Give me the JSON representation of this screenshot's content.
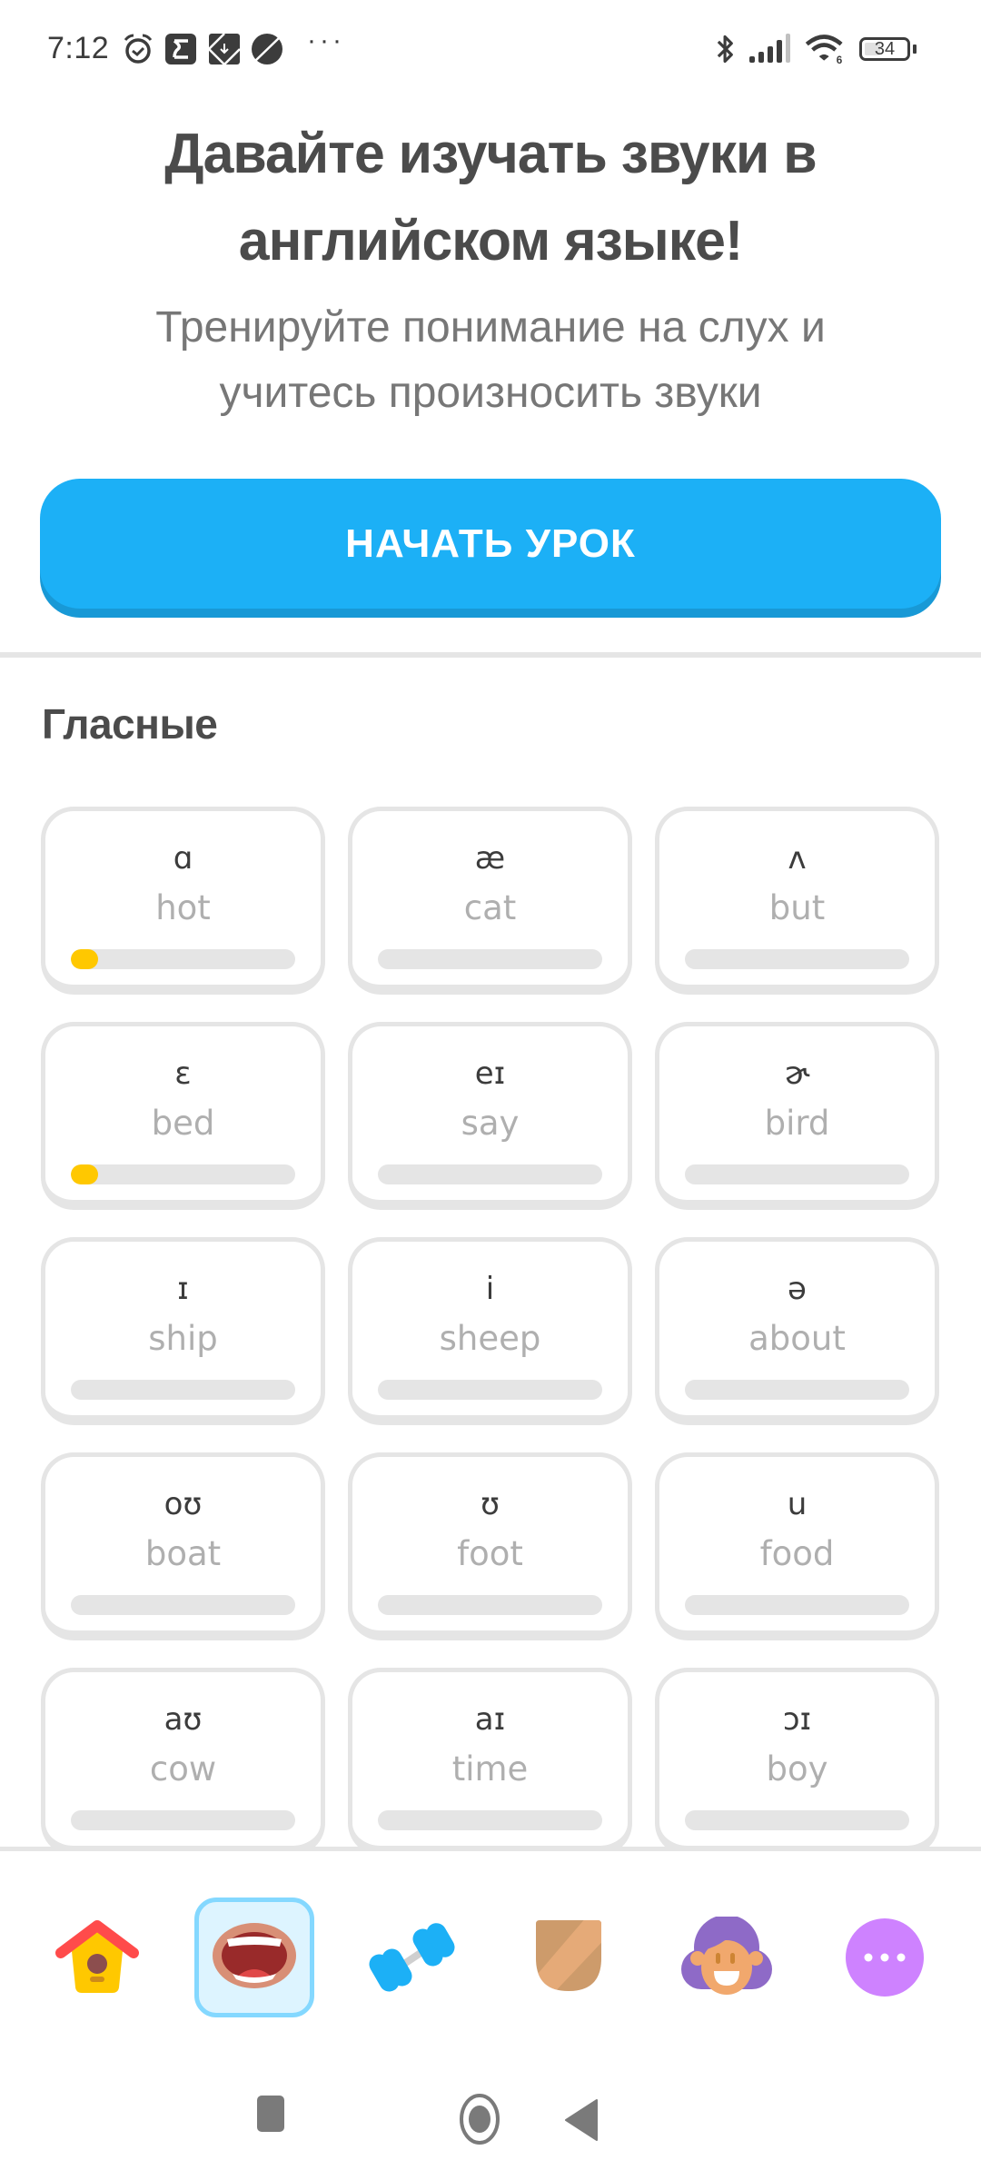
{
  "status_bar": {
    "time": "7:12",
    "left_icons": [
      "alarm-icon",
      "sigma-app-icon",
      "download-app-icon",
      "planet-app-icon"
    ],
    "more_notifications": "···",
    "right_icons": [
      "bluetooth-icon",
      "signal-icon",
      "wifi-icon"
    ],
    "wifi_badge": "6",
    "battery_percent": "34"
  },
  "header": {
    "title_line1": "Давайте изучать звуки в",
    "title_line2": "английском языке!",
    "subtitle_line1": "Тренируйте понимание на слух и",
    "subtitle_line2": "учитесь произносить звуки"
  },
  "start_button": {
    "label": "НАЧАТЬ УРОК"
  },
  "section": {
    "title": "Гласные"
  },
  "colors": {
    "accent": "#1cb0f6",
    "accent_shadow": "#1899d6",
    "progress_fill": "#ffc800",
    "progress_track": "#e5e5e5",
    "card_border": "#e5e5e5",
    "active_tab_bg": "#ddf4ff",
    "active_tab_border": "#84d8ff"
  },
  "vowels": [
    {
      "symbol": "ɑ",
      "word": "hot",
      "progress": 0.12
    },
    {
      "symbol": "æ",
      "word": "cat",
      "progress": 0
    },
    {
      "symbol": "ʌ",
      "word": "but",
      "progress": 0
    },
    {
      "symbol": "ɛ",
      "word": "bed",
      "progress": 0.12
    },
    {
      "symbol": "eɪ",
      "word": "say",
      "progress": 0
    },
    {
      "symbol": "ɚ",
      "word": "bird",
      "progress": 0
    },
    {
      "symbol": "ɪ",
      "word": "ship",
      "progress": 0
    },
    {
      "symbol": "i",
      "word": "sheep",
      "progress": 0
    },
    {
      "symbol": "ə",
      "word": "about",
      "progress": 0
    },
    {
      "symbol": "oʊ",
      "word": "boat",
      "progress": 0
    },
    {
      "symbol": "ʊ",
      "word": "foot",
      "progress": 0
    },
    {
      "symbol": "u",
      "word": "food",
      "progress": 0
    },
    {
      "symbol": "aʊ",
      "word": "cow",
      "progress": 0
    },
    {
      "symbol": "aɪ",
      "word": "time",
      "progress": 0
    },
    {
      "symbol": "ɔɪ",
      "word": "boy",
      "progress": 0
    }
  ],
  "bottom_nav": {
    "items": [
      {
        "name": "home",
        "icon": "birdhouse-icon",
        "active": false
      },
      {
        "name": "pronunciation",
        "icon": "mouth-icon",
        "active": true
      },
      {
        "name": "practice",
        "icon": "dumbbell-icon",
        "active": false
      },
      {
        "name": "leagues",
        "icon": "shield-icon",
        "active": false
      },
      {
        "name": "profile",
        "icon": "avatar-icon",
        "active": false
      },
      {
        "name": "more",
        "icon": "more-icon",
        "active": false
      }
    ]
  },
  "system_nav": [
    "recents-button",
    "home-button",
    "back-button"
  ]
}
